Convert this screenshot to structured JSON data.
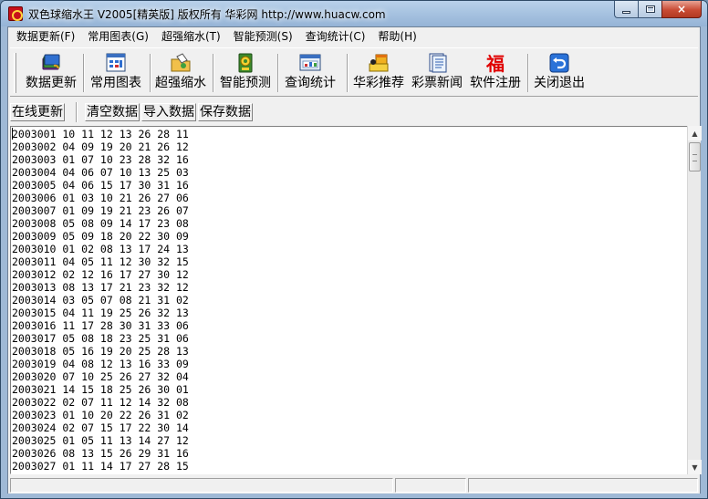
{
  "window": {
    "title": "双色球缩水王  V2005[精英版]  版权所有 华彩网 http://www.huacw.com",
    "caption": {
      "minimize": "minimize",
      "maximize": "maximize",
      "close": "×"
    }
  },
  "menu": [
    "数据更新(F)",
    "常用图表(G)",
    "超强缩水(T)",
    "智能预测(S)",
    "查询统计(C)",
    "帮助(H)"
  ],
  "toolbar": [
    {
      "label": "数据更新",
      "icon": "book-refresh-icon"
    },
    {
      "label": "常用图表",
      "icon": "chart-grid-icon"
    },
    {
      "label": "超强缩水",
      "icon": "shrink-folder-icon"
    },
    {
      "label": "智能预测",
      "icon": "predict-gear-icon"
    },
    {
      "label": "查询统计",
      "icon": "stats-window-icon"
    },
    {
      "label": "华彩推荐",
      "icon": "recommend-icon"
    },
    {
      "label": "彩票新闻",
      "icon": "news-doc-icon"
    },
    {
      "label": "软件注册",
      "icon": "fu-register-icon"
    },
    {
      "label": "关闭退出",
      "icon": "exit-arrow-icon"
    }
  ],
  "toolbar2": {
    "online_update": "在线更新",
    "clear": "清空数据",
    "import": "导入数据",
    "save": "保存数据"
  },
  "colors": {
    "title_bar": "#a6c2e0",
    "close_button": "#c94b34",
    "fu_red": "#e00000"
  },
  "draws": [
    "2003001 10 11 12 13 26 28 11",
    "2003002 04 09 19 20 21 26 12",
    "2003003 01 07 10 23 28 32 16",
    "2003004 04 06 07 10 13 25 03",
    "2003005 04 06 15 17 30 31 16",
    "2003006 01 03 10 21 26 27 06",
    "2003007 01 09 19 21 23 26 07",
    "2003008 05 08 09 14 17 23 08",
    "2003009 05 09 18 20 22 30 09",
    "2003010 01 02 08 13 17 24 13",
    "2003011 04 05 11 12 30 32 15",
    "2003012 02 12 16 17 27 30 12",
    "2003013 08 13 17 21 23 32 12",
    "2003014 03 05 07 08 21 31 02",
    "2003015 04 11 19 25 26 32 13",
    "2003016 11 17 28 30 31 33 06",
    "2003017 05 08 18 23 25 31 06",
    "2003018 05 16 19 20 25 28 13",
    "2003019 04 08 12 13 16 33 09",
    "2003020 07 10 25 26 27 32 04",
    "2003021 14 15 18 25 26 30 01",
    "2003022 02 07 11 12 14 32 08",
    "2003023 01 10 20 22 26 31 02",
    "2003024 02 07 15 17 22 30 14",
    "2003025 01 05 11 13 14 27 12",
    "2003026 08 13 15 26 29 31 16",
    "2003027 01 11 14 17 27 28 15"
  ],
  "statusbar": [
    "",
    "",
    ""
  ]
}
